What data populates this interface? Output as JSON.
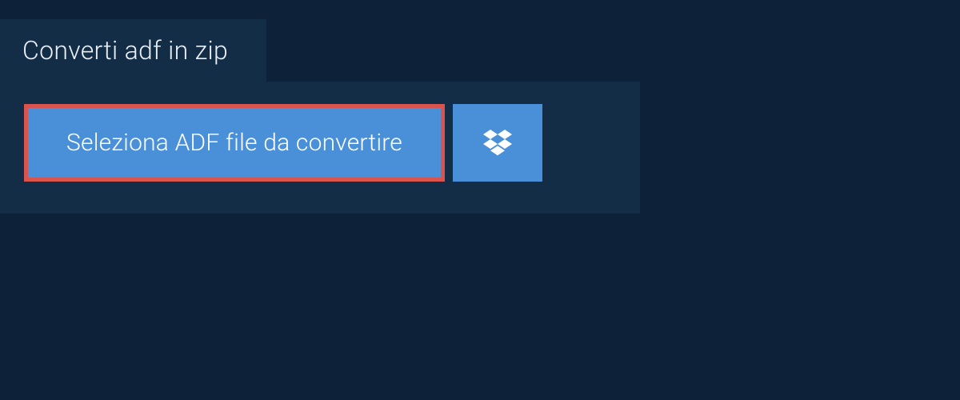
{
  "header": {
    "title": "Converti adf in zip"
  },
  "panel": {
    "select_label": "Seleziona ADF file da convertire",
    "dropbox_icon": "dropbox-icon"
  },
  "colors": {
    "background": "#0d2238",
    "panel": "#132d47",
    "button": "#4a90d9",
    "highlight_border": "#d9544f",
    "text_light": "#e8eef4",
    "text_white": "#ffffff"
  }
}
